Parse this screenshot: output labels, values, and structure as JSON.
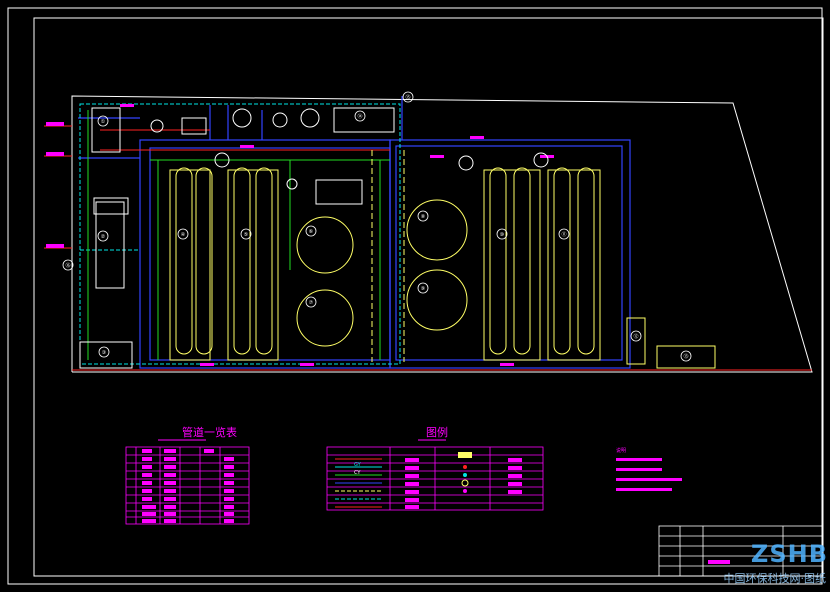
{
  "drawing": {
    "table1_title": "管道一览表",
    "table2_title": "图例",
    "legend_codes": [
      "GY",
      "CY"
    ],
    "building_numbers": [
      "①",
      "②",
      "③",
      "④",
      "⑤",
      "⑥",
      "⑦",
      "⑧",
      "⑨",
      "⑩",
      "⑪",
      "⑫",
      "⑬",
      "⑭",
      "⑮",
      "⑯"
    ],
    "notes_title": "说明"
  },
  "watermark": {
    "logo_text": "ZSHB",
    "site_text": "中国环保科技网·图纸"
  },
  "colors": {
    "background": "#000000",
    "frame": "#ffffff",
    "pipe_blue": "#3344ff",
    "pipe_cyan": "#00e6e6",
    "pipe_green": "#22dd22",
    "pipe_red": "#ff2222",
    "tank_yellow": "#ffff66",
    "table_magenta": "#ff00ff"
  }
}
